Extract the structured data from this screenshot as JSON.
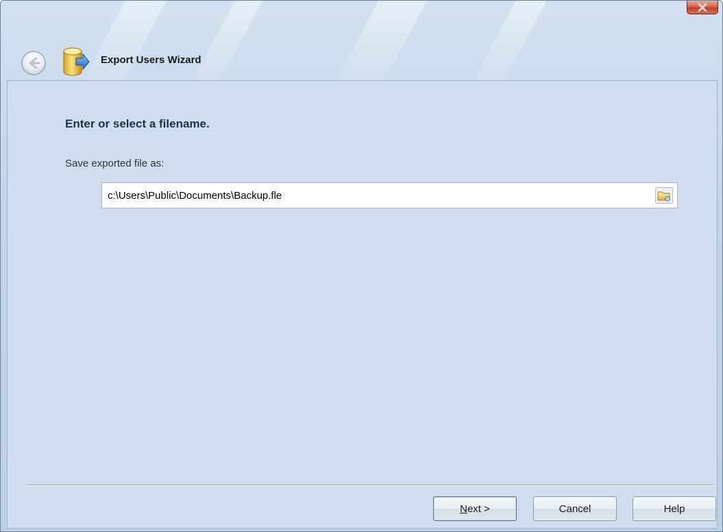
{
  "window": {
    "close_label": "x"
  },
  "header": {
    "title": "Export Users Wizard",
    "back_icon": "back-arrow-icon",
    "wizard_icon": "database-export-icon"
  },
  "main": {
    "heading": "Enter or select a filename.",
    "field_label": "Save exported file as:",
    "file_path": "c:\\Users\\Public\\Documents\\Backup.fle",
    "browse_icon": "folder-browse-icon"
  },
  "footer": {
    "next_mnemonic": "N",
    "next_rest": "ext >",
    "cancel_label": "Cancel",
    "help_label": "Help"
  },
  "colors": {
    "frame": "#c2d5e9",
    "content": "#cfddee",
    "heading": "#1e3150",
    "close": "#c2412a"
  }
}
